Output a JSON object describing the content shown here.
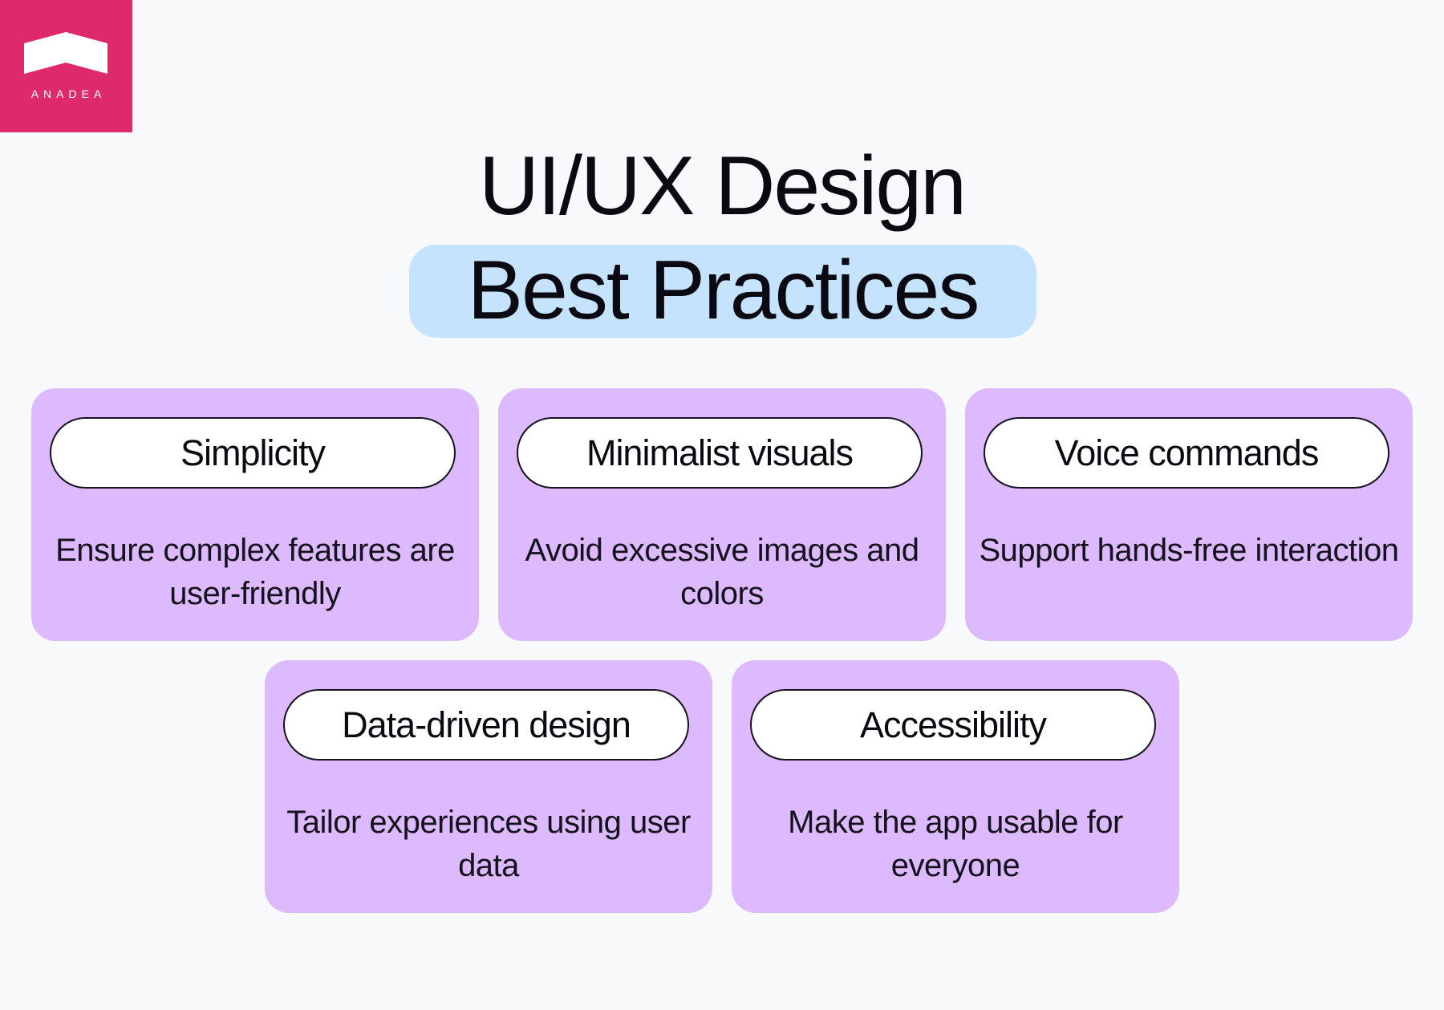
{
  "logo": {
    "text": "ANADEA"
  },
  "title": {
    "line1": "UI/UX Design",
    "line2": "Best Practices"
  },
  "colors": {
    "background": "#f8f9fb",
    "logo_brand": "#de2a6a",
    "title_highlight": "#c6e3fd",
    "card": "#ddb9fd",
    "pill": "#ffffff",
    "text": "#0b0a12"
  },
  "cards": [
    {
      "heading": "Simplicity",
      "description": "Ensure complex features are user-friendly"
    },
    {
      "heading": "Minimalist visuals",
      "description": "Avoid excessive images and colors"
    },
    {
      "heading": "Voice commands",
      "description": "Support hands-free interaction"
    },
    {
      "heading": "Data-driven design",
      "description": "Tailor experiences using user data"
    },
    {
      "heading": "Accessibility",
      "description": "Make the app usable for everyone"
    }
  ]
}
